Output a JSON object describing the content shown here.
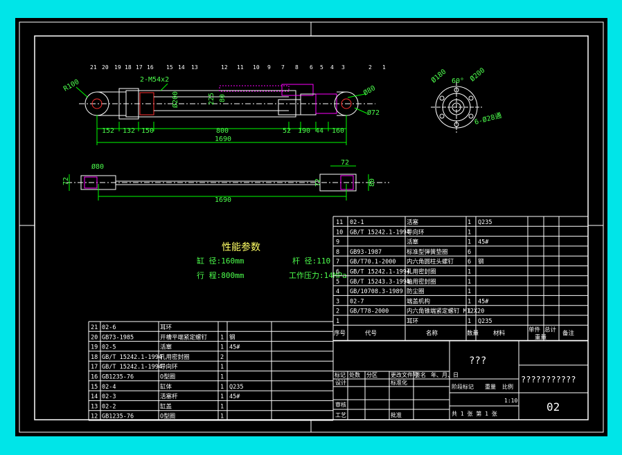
{
  "colors": {
    "background": "#000000",
    "frame": "#00e5e8",
    "line": "#ffffff",
    "dimension": "#00ff00",
    "section": "#ff3030",
    "hatch": "#ff00ff",
    "accent": "#ffff66"
  },
  "top_view": {
    "dims": [
      "152",
      "132",
      "150",
      "800",
      "52",
      "190",
      "44",
      "160",
      "1690"
    ],
    "callouts": [
      "R100",
      "2-M54x2",
      "Ø200",
      "225",
      "80",
      "Ø80",
      "Ø72"
    ],
    "balloons": [
      "21",
      "20",
      "19",
      "18",
      "17",
      "16",
      "15",
      "14",
      "13",
      "12",
      "11",
      "10",
      "9",
      "7",
      "8",
      "6",
      "5",
      "4",
      "3",
      "2",
      "1"
    ]
  },
  "bottom_view": {
    "dims": [
      "Ø80",
      "72",
      "1690",
      "72",
      "72",
      "80"
    ]
  },
  "flange_view": {
    "dims": [
      "Ø180",
      "60°",
      "Ø200",
      "6-Ø28通"
    ]
  },
  "performance": {
    "title": "性能参数",
    "bore_label": "缸   径:160mm",
    "rod_label": "杆   径:110",
    "stroke_label": "行   程:800mm",
    "pressure_label": "工作压力:14MPa"
  },
  "bom_upper": [
    {
      "no": "11",
      "code": "02-1",
      "name": "活塞",
      "qty": "1",
      "mat": "Q235"
    },
    {
      "no": "10",
      "code": "GB/T 15242.1-1994",
      "name": "导向环",
      "qty": "1",
      "mat": ""
    },
    {
      "no": "9",
      "code": "",
      "name": "活塞",
      "qty": "1",
      "mat": "45#"
    },
    {
      "no": "8",
      "code": "GB93-1987",
      "name": "标准型弹簧垫圈",
      "qty": "6",
      "mat": ""
    },
    {
      "no": "7",
      "code": "GB/T70.1-2000",
      "name": "内六角圆柱头螺钉",
      "qty": "6",
      "mat": "钢"
    },
    {
      "no": "6",
      "code": "GB/T 15242.1-1994",
      "name": "孔用密封圈",
      "qty": "1",
      "mat": ""
    },
    {
      "no": "5",
      "code": "GB/T 15243.3-1994",
      "name": "轴用密封圈",
      "qty": "1",
      "mat": ""
    },
    {
      "no": "4",
      "code": "GB/10708.3-1989",
      "name": "防尘圈",
      "qty": "1",
      "mat": ""
    },
    {
      "no": "3",
      "code": "02-7",
      "name": "端盖机构",
      "qty": "1",
      "mat": "45#"
    },
    {
      "no": "2",
      "code": "GB/T78-2000",
      "name": "内六角锥端紧定螺钉 M12X20",
      "qty": "1",
      "mat": ""
    },
    {
      "no": "1",
      "code": "",
      "name": "耳环",
      "qty": "1",
      "mat": "Q235"
    }
  ],
  "bom_upper_header": {
    "no": "序号",
    "code": "代号",
    "name": "名称",
    "qty": "数量",
    "mat": "材料",
    "single": "单件",
    "total": "总计",
    "weight": "重量",
    "remark": "备注"
  },
  "bom_lower": [
    {
      "no": "21",
      "code": "02-6",
      "name": "耳环",
      "qty": "",
      "mat": ""
    },
    {
      "no": "20",
      "code": "GB73-1985",
      "name": "开槽平端紧定螺钉",
      "qty": "1",
      "mat": "钢"
    },
    {
      "no": "19",
      "code": "02-5",
      "name": "活塞",
      "qty": "1",
      "mat": "45#"
    },
    {
      "no": "18",
      "code": "GB/T 15242.1-1994",
      "name": "孔用密封圈",
      "qty": "2",
      "mat": ""
    },
    {
      "no": "17",
      "code": "GB/T 15242.1-1994",
      "name": "导向环",
      "qty": "1",
      "mat": ""
    },
    {
      "no": "16",
      "code": "GB1235-76",
      "name": "O型圈",
      "qty": "1",
      "mat": ""
    },
    {
      "no": "15",
      "code": "02-4",
      "name": "缸体",
      "qty": "1",
      "mat": "Q235"
    },
    {
      "no": "14",
      "code": "02-3",
      "name": "活塞杆",
      "qty": "1",
      "mat": "45#"
    },
    {
      "no": "13",
      "code": "02-2",
      "name": "缸盖",
      "qty": "1",
      "mat": ""
    },
    {
      "no": "12",
      "code": "GB1235-76",
      "name": "O型圈",
      "qty": "1",
      "mat": ""
    }
  ],
  "title_block": {
    "marks": [
      "标记",
      "处数",
      "分区",
      "更改文件号",
      "签名",
      "年、月、日"
    ],
    "design": "设计",
    "std": "标准化",
    "check": "审核",
    "process": "工艺",
    "approve": "批准",
    "stage_labels": [
      "阶段标记",
      "重量",
      "比例"
    ],
    "scale": "1:10",
    "sheets": "共  1  张    第  1  张",
    "name": "???",
    "org": "???????????",
    "drawing_no": "02"
  }
}
